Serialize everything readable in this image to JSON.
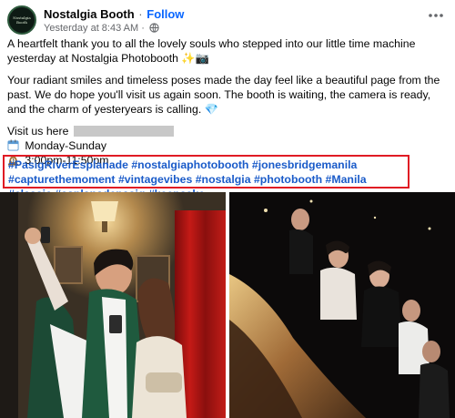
{
  "page": {
    "name": "Nostalgia Booth",
    "follow_label": "Follow",
    "separator": "·",
    "timestamp": "Yesterday at 8:43 AM",
    "timestamp_separator": "·",
    "avatar_text": "Nostalgia Booth"
  },
  "post": {
    "paragraph1": "A heartfelt thank you to all the lovely souls who stepped into our little time machine yesterday at Nostalgia Photobooth ✨📷",
    "paragraph2": "Your radiant smiles and timeless poses made the day feel like a beautiful page from the past. We do hope you'll visit us again soon. The booth is waiting, the camera is ready, and the charm of yesteryears is calling. 💎",
    "visit_label": "Visit us here",
    "days": "Monday-Sunday",
    "hours": "3:00pm-11:50pm",
    "hashtags": [
      "#PasigRiverEsplanade",
      "#nostalgiaphotobooth",
      "#jonesbridgemanila",
      "#capturethemoment",
      "#vintagevibes",
      "#nostalgia",
      "#photobooth",
      "#Manila",
      "#classic",
      "#esplanadepasig",
      "#keepsake"
    ]
  },
  "icons": {
    "globe": "globe-icon",
    "more": "more-options-icon",
    "calendar": "calendar-icon",
    "clock": "mantelpiece-clock-icon"
  },
  "colors": {
    "hashtag": "#1a5bc9",
    "highlight_border": "#e01b24",
    "follow": "#0866ff",
    "meta": "#65676b"
  }
}
